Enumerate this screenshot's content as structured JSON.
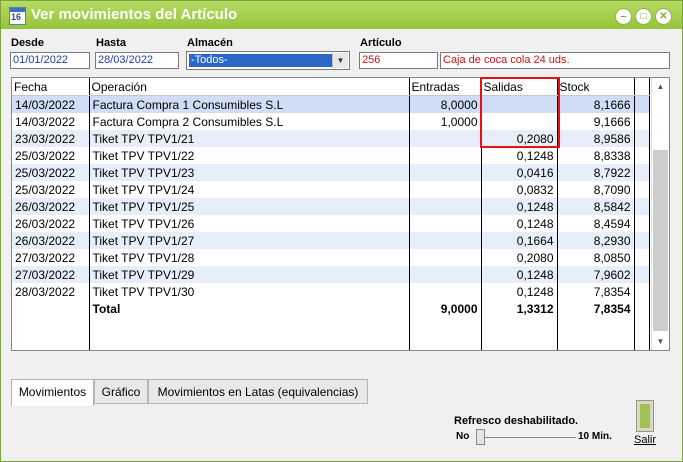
{
  "window": {
    "title": "Ver movimientos del Artículo",
    "icon_text": "16"
  },
  "filters": {
    "desde_label": "Desde",
    "desde_value": "01/01/2022",
    "hasta_label": "Hasta",
    "hasta_value": "28/03/2022",
    "almacen_label": "Almacén",
    "almacen_value": "-Todos-",
    "articulo_label": "Artículo",
    "articulo_code": "256",
    "articulo_name": "Caja de coca cola 24 uds."
  },
  "table": {
    "columns": [
      "Fecha",
      "Operación",
      "Entradas",
      "Salidas",
      "Stock"
    ],
    "rows": [
      [
        "14/03/2022",
        "Factura Compra 1 Consumibles S.L",
        "8,0000",
        "",
        "8,1666"
      ],
      [
        "14/03/2022",
        "Factura Compra 2 Consumibles S.L",
        "1,0000",
        "",
        "9,1666"
      ],
      [
        "23/03/2022",
        "Tiket TPV TPV1/21",
        "",
        "0,2080",
        "8,9586"
      ],
      [
        "25/03/2022",
        "Tiket TPV TPV1/22",
        "",
        "0,1248",
        "8,8338"
      ],
      [
        "25/03/2022",
        "Tiket TPV TPV1/23",
        "",
        "0,0416",
        "8,7922"
      ],
      [
        "25/03/2022",
        "Tiket TPV TPV1/24",
        "",
        "0,0832",
        "8,7090"
      ],
      [
        "26/03/2022",
        "Tiket TPV TPV1/25",
        "",
        "0,1248",
        "8,5842"
      ],
      [
        "26/03/2022",
        "Tiket TPV TPV1/26",
        "",
        "0,1248",
        "8,4594"
      ],
      [
        "26/03/2022",
        "Tiket TPV TPV1/27",
        "",
        "0,1664",
        "8,2930"
      ],
      [
        "27/03/2022",
        "Tiket TPV TPV1/28",
        "",
        "0,2080",
        "8,0850"
      ],
      [
        "27/03/2022",
        "Tiket TPV TPV1/29",
        "",
        "0,1248",
        "7,9602"
      ],
      [
        "28/03/2022",
        "Tiket TPV TPV1/30",
        "",
        "0,1248",
        "7,8354"
      ]
    ],
    "total": [
      "",
      "Total",
      "9,0000",
      "1,3312",
      "7,8354"
    ]
  },
  "tabs": [
    "Movimientos",
    "Gráfico",
    "Movimientos en Latas (equivalencias)"
  ],
  "refresh": {
    "label": "Refresco deshabilitado.",
    "min_label": "No",
    "max_label": "10 Min."
  },
  "exit_label": "Salir",
  "colors": {
    "titlebar": "#a6d04e",
    "selection": "#2b66c9",
    "highlight_box": "#e81010"
  }
}
